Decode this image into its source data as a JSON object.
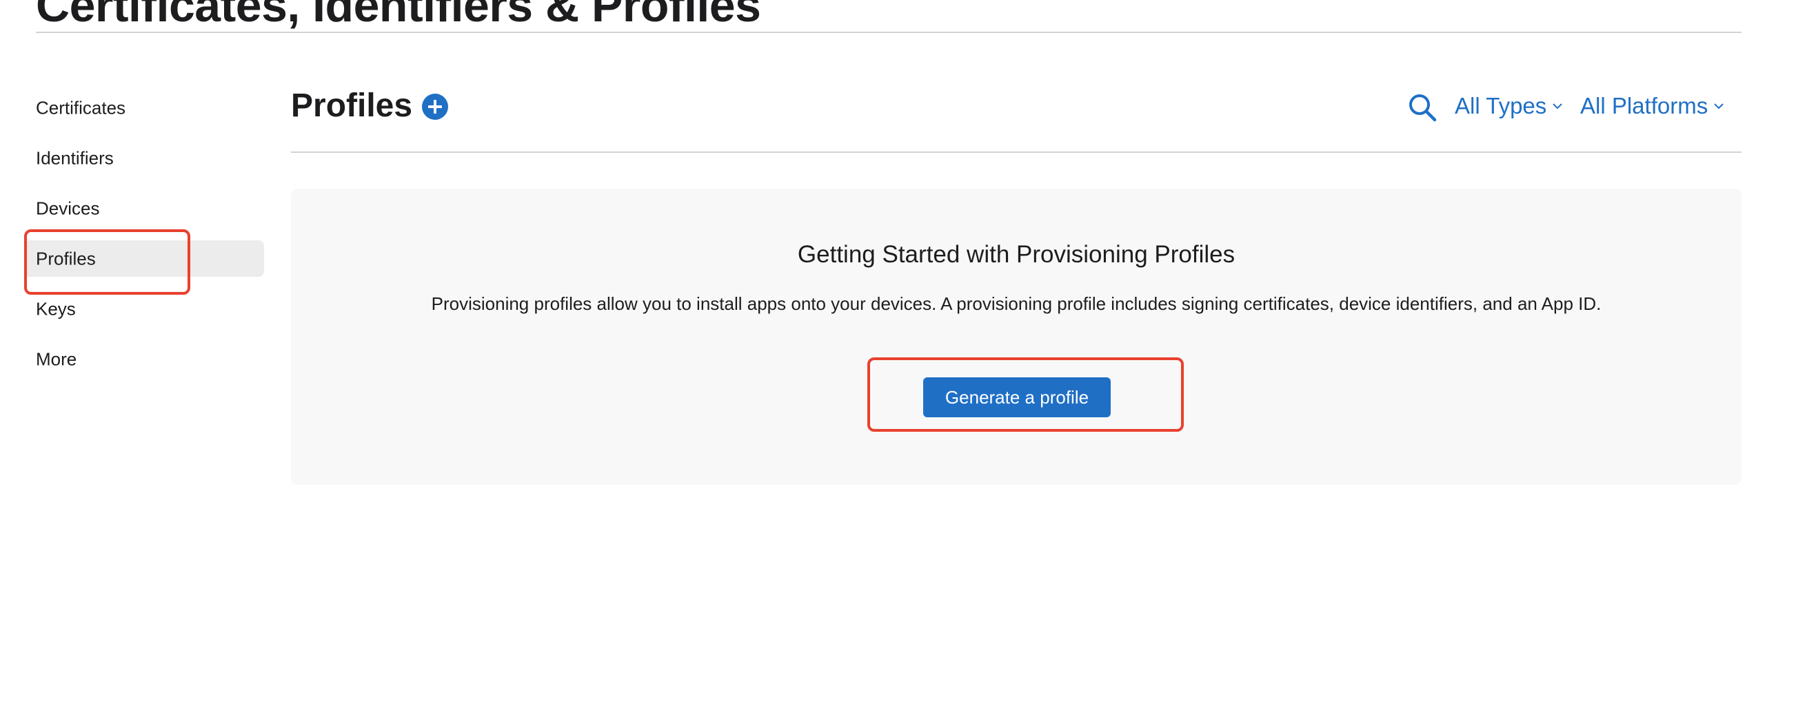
{
  "page": {
    "title": "Certificates, Identifiers & Profiles"
  },
  "sidebar": {
    "items": [
      {
        "label": "Certificates"
      },
      {
        "label": "Identifiers"
      },
      {
        "label": "Devices"
      },
      {
        "label": "Profiles",
        "active": true
      },
      {
        "label": "Keys"
      },
      {
        "label": "More"
      }
    ]
  },
  "main": {
    "title": "Profiles",
    "filters": {
      "types_label": "All Types",
      "platforms_label": "All Platforms"
    }
  },
  "empty_state": {
    "heading": "Getting Started with Provisioning Profiles",
    "description": "Provisioning profiles allow you to install apps onto your devices. A provisioning profile includes signing certificates, device identifiers, and an App ID.",
    "button_label": "Generate a profile"
  },
  "icons": {
    "add": "plus-circle-icon",
    "search": "search-icon",
    "dropdown": "chevron-down-icon"
  },
  "colors": {
    "accent": "#1f6fc5",
    "text": "#1d1d1f",
    "panel_background": "#f8f8f8",
    "active_item_background": "#ececec",
    "divider": "#d2d2d7",
    "annotation": "#e8412e"
  }
}
